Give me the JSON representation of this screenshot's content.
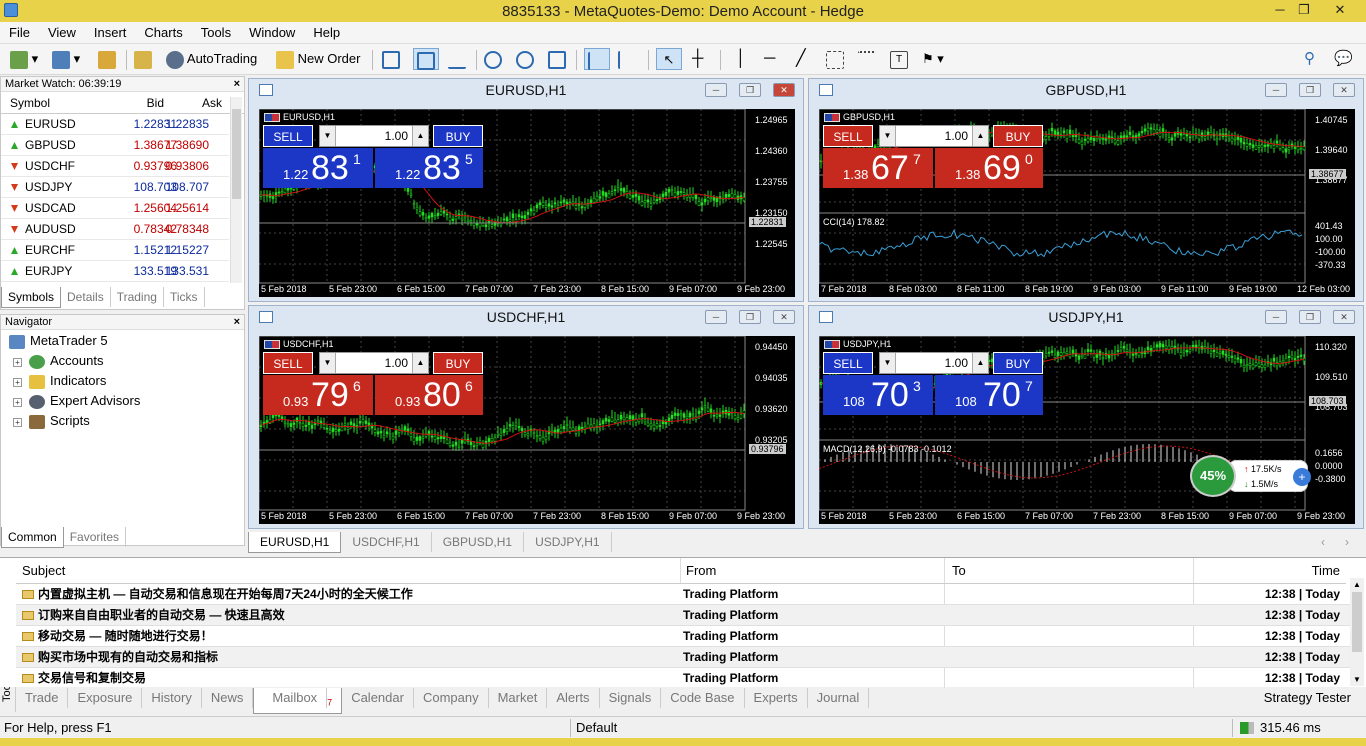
{
  "window": {
    "title": "8835133 - MetaQuotes-Demo: Demo Account - Hedge",
    "minimize": "─",
    "maximize": "❐",
    "close": "✕"
  },
  "menu": [
    "File",
    "View",
    "Insert",
    "Charts",
    "Tools",
    "Window",
    "Help"
  ],
  "toolbar": {
    "autotrading": "AutoTrading",
    "new_order": "New Order"
  },
  "market_watch": {
    "title": "Market Watch: 06:39:19",
    "close": "×",
    "columns": {
      "symbol": "Symbol",
      "bid": "Bid",
      "ask": "Ask"
    },
    "rows": [
      {
        "symbol": "EURUSD",
        "bid": "1.22831",
        "ask": "1.22835",
        "dir": "up",
        "color": "blue"
      },
      {
        "symbol": "GBPUSD",
        "bid": "1.38677",
        "ask": "1.38690",
        "dir": "up",
        "color": "red"
      },
      {
        "symbol": "USDCHF",
        "bid": "0.93796",
        "ask": "0.93806",
        "dir": "dn",
        "color": "red"
      },
      {
        "symbol": "USDJPY",
        "bid": "108.703",
        "ask": "108.707",
        "dir": "dn",
        "color": "blue"
      },
      {
        "symbol": "USDCAD",
        "bid": "1.25604",
        "ask": "1.25614",
        "dir": "dn",
        "color": "red"
      },
      {
        "symbol": "AUDUSD",
        "bid": "0.78342",
        "ask": "0.78348",
        "dir": "dn",
        "color": "red"
      },
      {
        "symbol": "EURCHF",
        "bid": "1.15212",
        "ask": "1.15227",
        "dir": "up",
        "color": "blue"
      },
      {
        "symbol": "EURJPY",
        "bid": "133.519",
        "ask": "133.531",
        "dir": "up",
        "color": "blue"
      }
    ],
    "tabs": [
      "Symbols",
      "Details",
      "Trading",
      "Ticks"
    ]
  },
  "navigator": {
    "title": "Navigator",
    "close": "×",
    "root": "MetaTrader 5",
    "items": [
      "Accounts",
      "Indicators",
      "Expert Advisors",
      "Scripts"
    ],
    "tabs": [
      "Common",
      "Favorites"
    ]
  },
  "charts": [
    {
      "title": "EURUSD,H1",
      "label": "EURUSD,H1",
      "sell": "SELL",
      "buy": "BUY",
      "qty": "1.00",
      "theme": "blue",
      "sell_small": "1.22",
      "sell_big": "83",
      "sell_sup": "1",
      "buy_small": "1.22",
      "buy_big": "83",
      "buy_sup": "5",
      "y_ticks": [
        "1.24965",
        "1.24360",
        "1.23755",
        "1.23150",
        "1.22545"
      ],
      "price": "1.22831",
      "x_ticks": [
        "5 Feb 2018",
        "5 Feb 23:00",
        "6 Feb 15:00",
        "7 Feb 07:00",
        "7 Feb 23:00",
        "8 Feb 15:00",
        "9 Feb 07:00",
        "9 Feb 23:00"
      ],
      "indicator": ""
    },
    {
      "title": "GBPUSD,H1",
      "label": "GBPUSD,H1",
      "sell": "SELL",
      "buy": "BUY",
      "qty": "1.00",
      "theme": "red",
      "sell_small": "1.38",
      "sell_big": "67",
      "sell_sup": "7",
      "buy_small": "1.38",
      "buy_big": "69",
      "buy_sup": "0",
      "y_ticks": [
        "1.40745",
        "1.39640",
        "1.38677"
      ],
      "price": "1.38677",
      "ind_ticks": [
        "401.43",
        "100.00",
        "-100.00",
        "-370.33"
      ],
      "x_ticks": [
        "7 Feb 2018",
        "8 Feb 03:00",
        "8 Feb 11:00",
        "8 Feb 19:00",
        "9 Feb 03:00",
        "9 Feb 11:00",
        "9 Feb 19:00",
        "12 Feb 03:00"
      ],
      "indicator": "CCI(14) 178.82"
    },
    {
      "title": "USDCHF,H1",
      "label": "USDCHF,H1",
      "sell": "SELL",
      "buy": "BUY",
      "qty": "1.00",
      "theme": "red",
      "sell_small": "0.93",
      "sell_big": "79",
      "sell_sup": "6",
      "buy_small": "0.93",
      "buy_big": "80",
      "buy_sup": "6",
      "y_ticks": [
        "0.94450",
        "0.94035",
        "0.93620",
        "0.93205"
      ],
      "price": "0.93796",
      "x_ticks": [
        "5 Feb 2018",
        "5 Feb 23:00",
        "6 Feb 15:00",
        "7 Feb 07:00",
        "7 Feb 23:00",
        "8 Feb 15:00",
        "9 Feb 07:00",
        "9 Feb 23:00"
      ],
      "indicator": ""
    },
    {
      "title": "USDJPY,H1",
      "label": "USDJPY,H1",
      "sell": "SELL",
      "buy": "BUY",
      "qty": "1.00",
      "theme": "blue",
      "sell_small": "108",
      "sell_big": "70",
      "sell_sup": "3",
      "buy_small": "108",
      "buy_big": "70",
      "buy_sup": "7",
      "y_ticks": [
        "110.320",
        "109.510",
        "108.703"
      ],
      "price": "108.703",
      "ind_ticks": [
        "0.1656",
        "0.0000",
        "-0.3800"
      ],
      "x_ticks": [
        "5 Feb 2018",
        "5 Feb 23:00",
        "6 Feb 15:00",
        "7 Feb 07:00",
        "7 Feb 23:00",
        "8 Feb 15:00",
        "9 Feb 07:00",
        "9 Feb 23:00"
      ],
      "indicator": "MACD(12,26,9) -0.0783 -0.1012"
    }
  ],
  "speed_widget": {
    "percent": "45%",
    "up": "17.5K/s",
    "down": "1.5M/s"
  },
  "chart_tabs": [
    "EURUSD,H1",
    "USDCHF,H1",
    "GBPUSD,H1",
    "USDJPY,H1"
  ],
  "toolbox": {
    "side_label": "Toolbox",
    "close": "×",
    "columns": {
      "subject": "Subject",
      "from": "From",
      "to": "To",
      "time": "Time"
    },
    "messages": [
      {
        "subject": "内置虚拟主机 — 自动交易和信息现在开始每周7天24小时的全天候工作",
        "from": "Trading Platform",
        "to": "",
        "time": "12:38 | Today"
      },
      {
        "subject": "订购来自自由职业者的自动交易 — 快速且高效",
        "from": "Trading Platform",
        "to": "",
        "time": "12:38 | Today"
      },
      {
        "subject": "移动交易 — 随时随地进行交易！",
        "from": "Trading Platform",
        "to": "",
        "time": "12:38 | Today"
      },
      {
        "subject": "购买市场中现有的自动交易和指标",
        "from": "Trading Platform",
        "to": "",
        "time": "12:38 | Today"
      },
      {
        "subject": "交易信号和复制交易",
        "from": "Trading Platform",
        "to": "",
        "time": "12:38 | Today"
      }
    ],
    "tabs": [
      "Trade",
      "Exposure",
      "History",
      "News",
      "Mailbox",
      "Calendar",
      "Company",
      "Market",
      "Alerts",
      "Signals",
      "Code Base",
      "Experts",
      "Journal"
    ],
    "mailbox_count": "7",
    "strategy_tester": "Strategy Tester"
  },
  "status": {
    "help": "For Help, press F1",
    "profile": "Default",
    "ping": "315.46 ms"
  },
  "colors": {
    "sell_red": "#c62a1e",
    "buy_blue": "#1c37c6",
    "candle_green": "#22dd22",
    "ma_red": "#d01010"
  }
}
